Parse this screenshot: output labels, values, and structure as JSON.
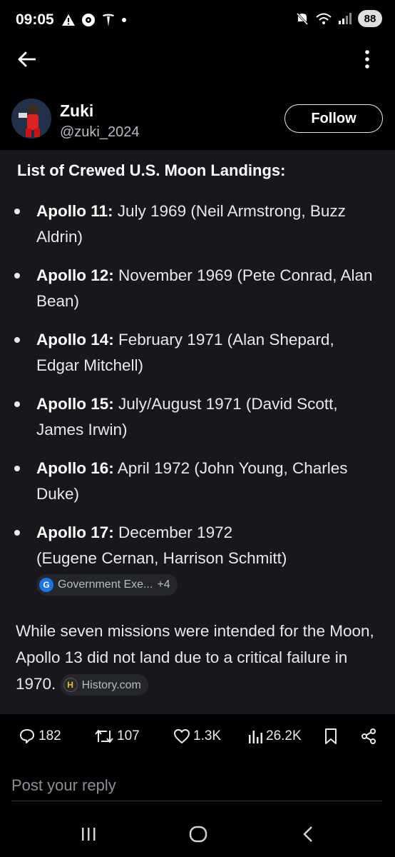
{
  "status_bar": {
    "time": "09:05",
    "battery": "88",
    "left_icons": [
      "warning-icon",
      "music-icon",
      "tesla-icon",
      "dot-icon"
    ],
    "right_icons": [
      "mute-icon",
      "wifi-icon",
      "signal-icon"
    ]
  },
  "nav": {
    "back_icon": "arrow-left-icon",
    "more_icon": "more-vertical-icon"
  },
  "author": {
    "name": "Zuki",
    "handle": "@zuki_2024",
    "follow_label": "Follow"
  },
  "post": {
    "list_title": "List of Crewed U.S. Moon Landings:",
    "missions": [
      {
        "name": "Apollo 11:",
        "detail": " July 1969 (Neil Armstrong, Buzz Aldrin)"
      },
      {
        "name": "Apollo 12:",
        "detail": " November 1969 (Pete Conrad, Alan Bean)"
      },
      {
        "name": "Apollo 14:",
        "detail": " February 1971 (Alan Shepard, Edgar Mitchell)"
      },
      {
        "name": "Apollo 15:",
        "detail": " July/August 1971 (David Scott, James Irwin)"
      },
      {
        "name": "Apollo 16:",
        "detail": " April 1972 (John Young, Charles Duke)"
      },
      {
        "name": "Apollo 17:",
        "detail": " December 1972 (Eugene Cernan, Harrison Schmitt)"
      }
    ],
    "source_1": {
      "label": "Government Exe...",
      "extra": "+4",
      "icon": "G"
    },
    "summary": "While seven missions were intended for the Moon, Apollo 13 did not land due to a critical failure in 1970.",
    "source_2": {
      "label": "History.com",
      "icon": "H"
    }
  },
  "actions": {
    "replies": "182",
    "reposts": "107",
    "likes": "1.3K",
    "views": "26.2K"
  },
  "reply": {
    "placeholder": "Post your reply"
  },
  "colors": {
    "background": "#000000",
    "card": "#17181c",
    "text": "#e7e9ea",
    "muted": "#b6bcc2"
  }
}
